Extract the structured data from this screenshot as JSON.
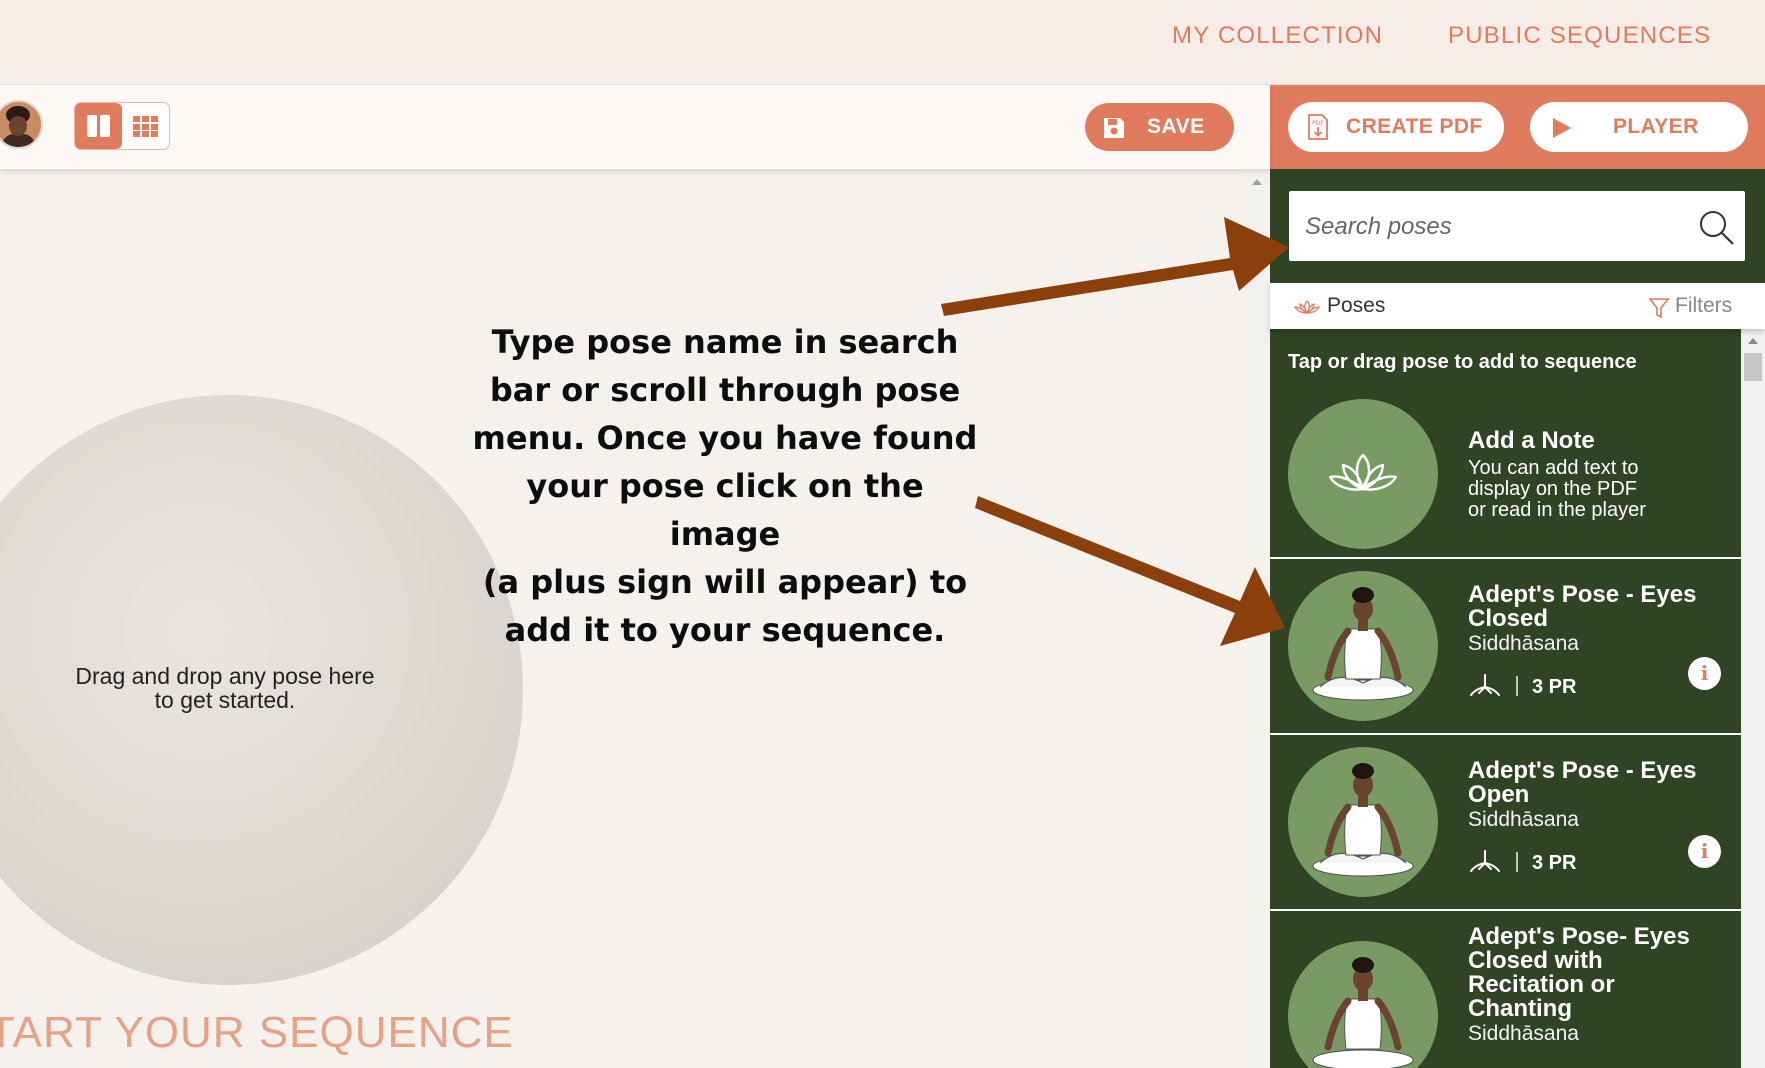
{
  "nav": {
    "my_collection": "MY COLLECTION",
    "public_sequences": "PUBLIC SEQUENCES"
  },
  "toolbar": {
    "save_label": "SAVE"
  },
  "canvas": {
    "drop_text_line1": "Drag and drop any pose here",
    "drop_text_line2": "to get started.",
    "start_label": "TART YOUR SEQUENCE"
  },
  "annotation": {
    "lines": [
      "Type pose name in search",
      "bar or scroll through pose",
      "menu. Once you have found",
      "your pose click on the image",
      "(a plus sign will appear) to",
      "add it to your sequence."
    ],
    "arrow_color": "#8b3f0b"
  },
  "panel": {
    "create_pdf_label": "CREATE PDF",
    "player_label": "PLAYER",
    "search_placeholder": "Search poses",
    "tab_poses": "Poses",
    "tab_filters": "Filters",
    "hint": "Tap or drag pose to add to sequence",
    "note_card": {
      "title": "Add a Note",
      "desc": [
        "You can add text to",
        "display on the PDF",
        "or read in the player"
      ]
    },
    "poses": [
      {
        "title_line1": "Adept's Pose - Eyes",
        "title_line2": "Closed",
        "sanskrit": "Siddhāsana",
        "code": "3 PR"
      },
      {
        "title_line1": "Adept's Pose - Eyes",
        "title_line2": "Open",
        "sanskrit": "Siddhāsana",
        "code": "3 PR"
      },
      {
        "title_lines": [
          "Adept's Pose- Eyes",
          "Closed with",
          "Recitation or",
          "Chanting"
        ],
        "sanskrit": "Siddhāsana"
      }
    ]
  },
  "colors": {
    "accent": "#e07b5e",
    "panel_green": "#2e4424",
    "pose_circle": "#7a9a63",
    "nav_bg": "#f7ede8"
  }
}
